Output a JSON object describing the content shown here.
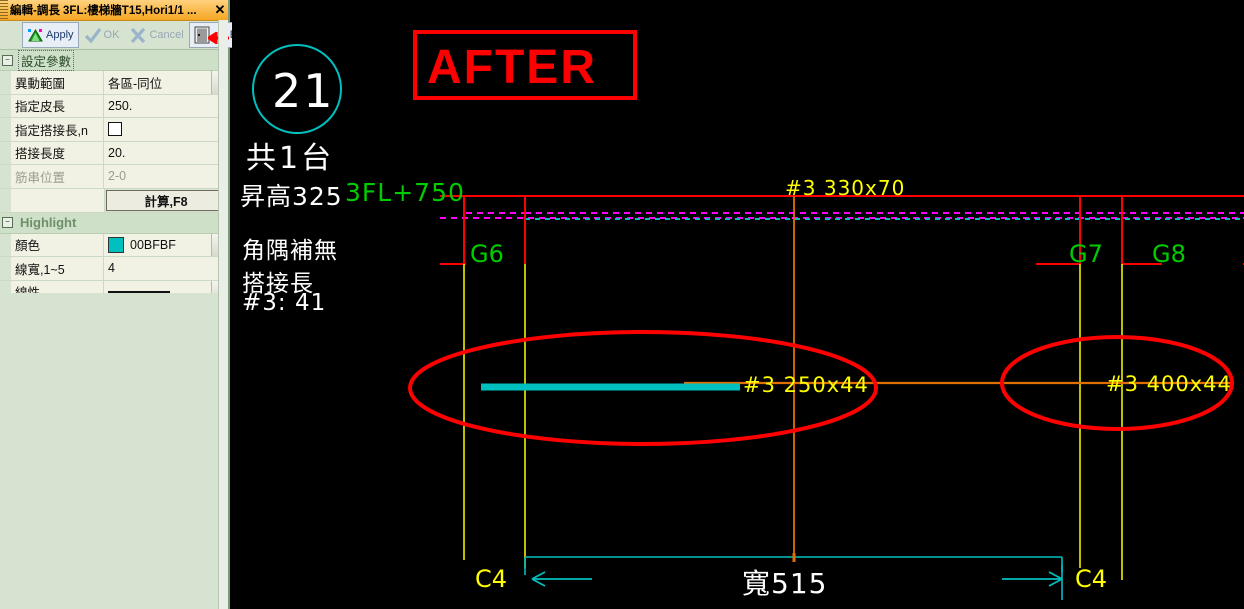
{
  "window": {
    "title": "編輯-調長 3FL:樓梯牆T15,Hori1/1 ...",
    "close_label": "✕"
  },
  "toolbar": {
    "apply_label": "Apply",
    "ok_label": "OK",
    "cancel_label": "Cancel",
    "exit_label": "Exit"
  },
  "properties": {
    "group1_title": "設定參數",
    "rows": [
      {
        "key": "異動範圍",
        "value": "各區-同位",
        "chevron": true
      },
      {
        "key": "指定皮長",
        "value": "250.",
        "chevron": false
      },
      {
        "key": "指定搭接長,n",
        "value": "",
        "chevron": false
      },
      {
        "key": "搭接長度",
        "value": "20.",
        "chevron": false
      },
      {
        "key": "筋串位置",
        "value": "2-0",
        "chevron": false
      }
    ],
    "calc_button": "計算,F8",
    "group2_title": "Highlight",
    "hl_rows": [
      {
        "key": "顏色",
        "value": "00BFBF",
        "chevron": true
      },
      {
        "key": "線寬,1~5",
        "value": "4",
        "chevron": false
      },
      {
        "key": "線性",
        "value": "",
        "chevron": true
      }
    ],
    "highlight_color": "#00BFBF"
  },
  "cad": {
    "bubble_number": "21",
    "total_label": "共1台",
    "rise_label": "昇高325",
    "level_label": "3FL+750",
    "corner_label": "角隅補無",
    "lap_label": "搭接長",
    "lap_value": "#3:   41",
    "after_label": "AFTER",
    "top_bar_label": "#3  330x70",
    "mid_bar_left_label": "#3  250x44",
    "mid_bar_right_label": "#3  400x44",
    "girder_g6": "G6",
    "girder_g7": "G7",
    "girder_g8": "G8",
    "col_left": "C4",
    "col_right": "C4",
    "width_label": "寬515",
    "colors": {
      "red": "#FF0000",
      "yellow": "#FFFF00",
      "green": "#00CC00",
      "cyan": "#00BFBF",
      "magenta": "#FF00FF",
      "orange": "#E07000",
      "white": "#FFFFFF"
    }
  }
}
